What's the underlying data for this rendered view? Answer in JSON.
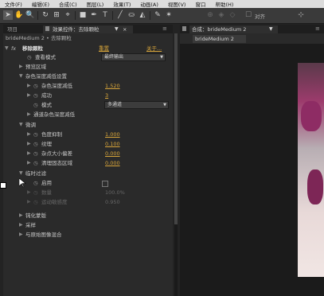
{
  "menu": [
    "文件(F)",
    "编辑(E)",
    "合成(C)",
    "图层(L)",
    "效果(T)",
    "动画(A)",
    "视图(V)",
    "窗口",
    "帮助(H)"
  ],
  "toolbar": {
    "align_label": "对齐"
  },
  "left_tabs": {
    "project": "项目",
    "effects": "效果控件：去除颗粒",
    "close": "×"
  },
  "layer_path": "brideMedium 2 • 去除颗粒",
  "right_tabs": {
    "comp": "合成：brideMedium 2",
    "sub": "brideMedium 2"
  },
  "effect": {
    "fx": "fx",
    "name": "移除颗粒",
    "reset": "重置",
    "about": "关于..."
  },
  "params": {
    "view_mode_label": "查看模式",
    "view_mode_value": "最终输出",
    "preview_region": "预览区域",
    "noise_reduction": "杂色深度减低设置",
    "noise_reduction_amount_label": "杂色深度减低",
    "noise_reduction_amount_value": "1.520",
    "passes_label": "成功",
    "passes_value": "3",
    "mode_label": "模式",
    "mode_value": "多通道",
    "channel_noise": "通道杂色深度减低",
    "fine_tuning": "微调",
    "chroma_suppression_label": "色度抑制",
    "chroma_suppression_value": "1.000",
    "texture_label": "纹理",
    "texture_value": "0.100",
    "noise_size_bias_label": "杂点大小偏差",
    "noise_size_bias_value": "0.000",
    "clean_solid_areas_label": "清理固态区域",
    "clean_solid_areas_value": "0.000",
    "temporal_filtering": "临时过滤",
    "enable_label": "启用",
    "amount_label": "数量",
    "amount_value": "100.0%",
    "motion_sensitivity_label": "运动敏感度",
    "motion_sensitivity_value": "0.950",
    "unsharp_mask": "钝化蒙版",
    "sampling": "采样",
    "blend_with_original": "与原始图像混合"
  }
}
